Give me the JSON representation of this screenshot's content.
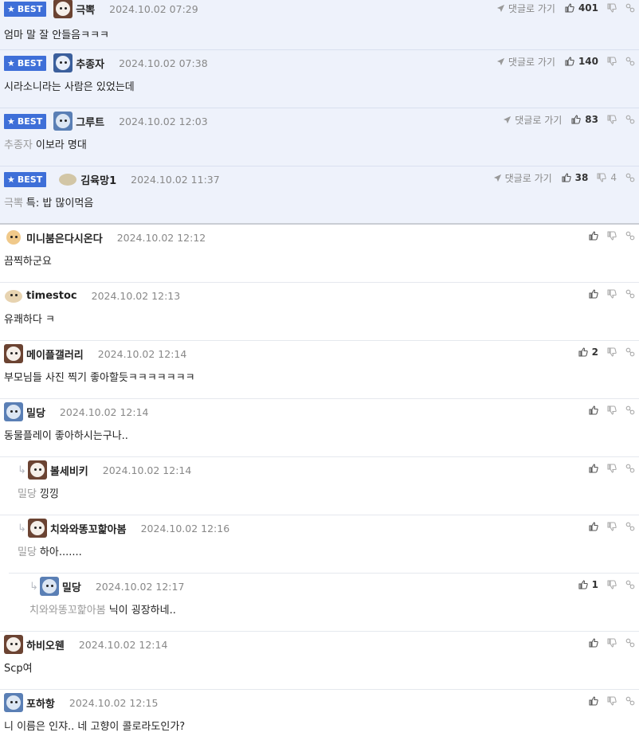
{
  "labels": {
    "best": "BEST",
    "reply": "댓글로 가기"
  },
  "comments": [
    {
      "nick": "극뽁",
      "date": "2024.10.02 07:29",
      "mention": "",
      "text": "엄마 말 잘 안들음ㅋㅋㅋ",
      "likes": "401",
      "dislikes": ""
    },
    {
      "nick": "추종자",
      "date": "2024.10.02 07:38",
      "mention": "",
      "text": "시라소니라는 사람은 있었는데",
      "likes": "140",
      "dislikes": ""
    },
    {
      "nick": "그루트",
      "date": "2024.10.02 12:03",
      "mention": "추종자",
      "text": "이보라 명대",
      "likes": "83",
      "dislikes": ""
    },
    {
      "nick": "김육망1",
      "date": "2024.10.02 11:37",
      "mention": "극뽁",
      "text": "특: 밥 많이먹음",
      "likes": "38",
      "dislikes": "4"
    },
    {
      "nick": "미니붐은다시온다",
      "date": "2024.10.02 12:12",
      "mention": "",
      "text": "끔찍하군요",
      "likes": "",
      "dislikes": ""
    },
    {
      "nick": "timestoc",
      "date": "2024.10.02 12:13",
      "mention": "",
      "text": "유쾌하다 ㅋ",
      "likes": "",
      "dislikes": ""
    },
    {
      "nick": "메이플갤러리",
      "date": "2024.10.02 12:14",
      "mention": "",
      "text": "부모님들 사진 찍기 좋아할듯ㅋㅋㅋㅋㅋㅋㅋ",
      "likes": "2",
      "dislikes": ""
    },
    {
      "nick": "밀당",
      "date": "2024.10.02 12:14",
      "mention": "",
      "text": "동물플레이 좋아하시는구나..",
      "likes": "",
      "dislikes": ""
    },
    {
      "nick": "볼세비키",
      "date": "2024.10.02 12:14",
      "mention": "밀당",
      "text": "낑낑",
      "likes": "",
      "dislikes": ""
    },
    {
      "nick": "치와와똥꼬핥아봄",
      "date": "2024.10.02 12:16",
      "mention": "밀당",
      "text": "하아.......",
      "likes": "",
      "dislikes": ""
    },
    {
      "nick": "밀당",
      "date": "2024.10.02 12:17",
      "mention": "치와와똥꼬핥아봄",
      "text": "닉이 굉장하네..",
      "likes": "1",
      "dislikes": ""
    },
    {
      "nick": "하비오웬",
      "date": "2024.10.02 12:14",
      "mention": "",
      "text": "Scp여",
      "likes": "",
      "dislikes": ""
    },
    {
      "nick": "포하항",
      "date": "2024.10.02 12:15",
      "mention": "",
      "text": "니 이름은 인쟈.. 네 고향이 콜로라도인가?",
      "likes": "",
      "dislikes": ""
    }
  ]
}
